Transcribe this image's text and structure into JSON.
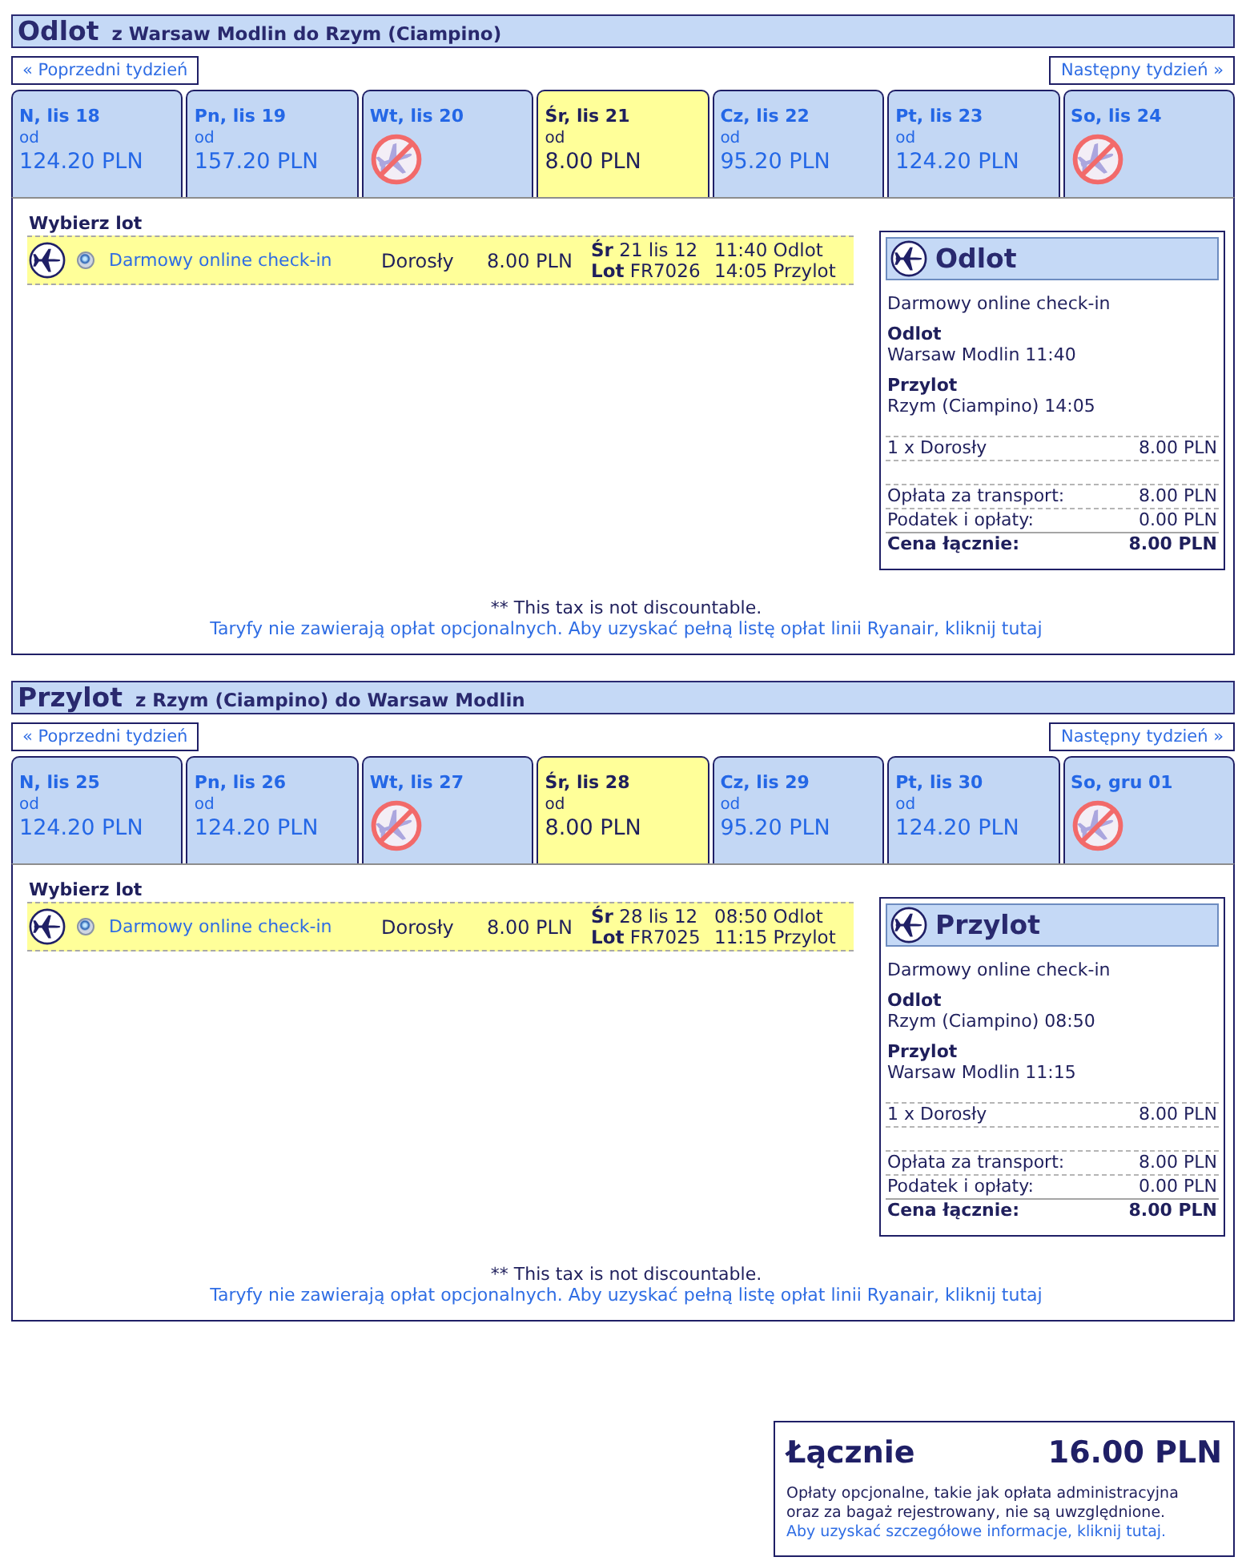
{
  "sections": [
    {
      "title": "Odlot",
      "route": "z Warsaw Modlin do Rzym (Ciampino)",
      "prev_week": "« Poprzedni tydzień",
      "next_week": "Następny tydzień »",
      "days": [
        {
          "label": "N, lis 18",
          "from": "od",
          "price": "124.20 PLN",
          "available": true,
          "selected": false
        },
        {
          "label": "Pn, lis 19",
          "from": "od",
          "price": "157.20 PLN",
          "available": true,
          "selected": false
        },
        {
          "label": "Wt, lis 20",
          "available": false,
          "selected": false
        },
        {
          "label": "Śr, lis 21",
          "from": "od",
          "price": "8.00 PLN",
          "available": true,
          "selected": true
        },
        {
          "label": "Cz, lis 22",
          "from": "od",
          "price": "95.20 PLN",
          "available": true,
          "selected": false
        },
        {
          "label": "Pt, lis 23",
          "from": "od",
          "price": "124.20 PLN",
          "available": true,
          "selected": false
        },
        {
          "label": "So, lis 24",
          "available": false,
          "selected": false
        }
      ],
      "flights_heading": "Wybierz lot",
      "flights": [
        {
          "selected": true,
          "fare": "Darmowy online check-in",
          "passenger": "Dorosły",
          "price": "8.00 PLN",
          "date": "**Śr** 21 lis 12",
          "flight": "**Lot** FR7026",
          "departure": "11:40 Odlot",
          "arrival": "14:05 Przylot"
        }
      ],
      "summary": {
        "title": "Odlot",
        "fare": "Darmowy online check-in",
        "departure_label": "Odlot",
        "departure": "Warsaw Modlin 11:40",
        "arrival_label": "Przylot",
        "arrival": "Rzym (Ciampino) 14:05",
        "lines": [
          {
            "label": "1 x Dorosły",
            "value": "8.00 PLN"
          }
        ],
        "costs": [
          {
            "label": "Opłata za transport:",
            "value": "8.00 PLN"
          },
          {
            "label": "Podatek i opłaty:",
            "value": "0.00 PLN"
          }
        ],
        "total": {
          "label": "Cena łącznie:",
          "value": "8.00 PLN"
        }
      },
      "tax_note": "** This tax is not discountable.",
      "fees_link": "Taryfy nie zawierają opłat opcjonalnych. Aby uzyskać pełną listę opłat linii Ryanair, kliknij tutaj"
    },
    {
      "title": "Przylot",
      "route": "z Rzym (Ciampino) do Warsaw Modlin",
      "prev_week": "« Poprzedni tydzień",
      "next_week": "Następny tydzień »",
      "days": [
        {
          "label": "N, lis 25",
          "from": "od",
          "price": "124.20 PLN",
          "available": true,
          "selected": false
        },
        {
          "label": "Pn, lis 26",
          "from": "od",
          "price": "124.20 PLN",
          "available": true,
          "selected": false
        },
        {
          "label": "Wt, lis 27",
          "available": false,
          "selected": false
        },
        {
          "label": "Śr, lis 28",
          "from": "od",
          "price": "8.00 PLN",
          "available": true,
          "selected": true
        },
        {
          "label": "Cz, lis 29",
          "from": "od",
          "price": "95.20 PLN",
          "available": true,
          "selected": false
        },
        {
          "label": "Pt, lis 30",
          "from": "od",
          "price": "124.20 PLN",
          "available": true,
          "selected": false
        },
        {
          "label": "So, gru 01",
          "available": false,
          "selected": false
        }
      ],
      "flights_heading": "Wybierz lot",
      "flights": [
        {
          "selected": true,
          "fare": "Darmowy online check-in",
          "passenger": "Dorosły",
          "price": "8.00 PLN",
          "date": "**Śr** 28 lis 12",
          "flight": "**Lot** FR7025",
          "departure": "08:50 Odlot",
          "arrival": "11:15 Przylot"
        }
      ],
      "summary": {
        "title": "Przylot",
        "fare": "Darmowy online check-in",
        "departure_label": "Odlot",
        "departure": "Rzym (Ciampino) 08:50",
        "arrival_label": "Przylot",
        "arrival": "Warsaw Modlin 11:15",
        "lines": [
          {
            "label": "1 x Dorosły",
            "value": "8.00 PLN"
          }
        ],
        "costs": [
          {
            "label": "Opłata za transport:",
            "value": "8.00 PLN"
          },
          {
            "label": "Podatek i opłaty:",
            "value": "0.00 PLN"
          }
        ],
        "total": {
          "label": "Cena łącznie:",
          "value": "8.00 PLN"
        }
      },
      "tax_note": "** This tax is not discountable.",
      "fees_link": "Taryfy nie zawierają opłat opcjonalnych. Aby uzyskać pełną listę opłat linii Ryanair, kliknij tutaj"
    }
  ],
  "total": {
    "label": "Łącznie",
    "value": "16.00 PLN",
    "note": "Opłaty opcjonalne, takie jak opłata administracyjna oraz za bagaż rejestrowany, nie są uwzględnione.",
    "link": "Aby uzyskać szczegółowe informacje, kliknij tutaj."
  }
}
